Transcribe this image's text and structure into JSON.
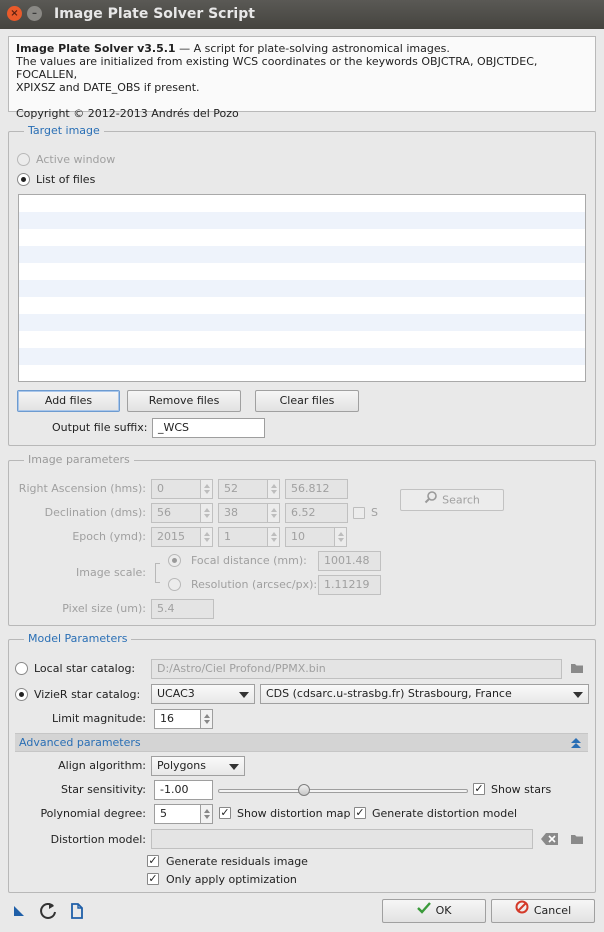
{
  "window": {
    "title": "Image Plate Solver Script",
    "close_glyph": "×",
    "min_glyph": "–"
  },
  "info": {
    "name": "Image Plate Solver v3.5.1",
    "tagline": " — A script for plate-solving astronomical images.",
    "line2": "The values are initialized from existing WCS coordinates or the keywords OBJCTRA, OBJCTDEC, FOCALLEN,",
    "line3": "XPIXSZ and DATE_OBS if present.",
    "copyright": "Copyright © 2012-2013 Andrés del Pozo"
  },
  "target": {
    "legend": "Target image",
    "active_window": "Active window",
    "list_of_files": "List of files",
    "add_files": "Add files",
    "remove_files": "Remove files",
    "clear_files": "Clear files",
    "suffix_label": "Output file suffix:",
    "suffix_value": "_WCS"
  },
  "image": {
    "legend": "Image parameters",
    "ra_label": "Right Ascension (hms):",
    "ra": [
      "0",
      "52",
      "56.812"
    ],
    "dec_label": "Declination (dms):",
    "dec": [
      "56",
      "38",
      "6.52"
    ],
    "s_label": "S",
    "epoch_label": "Epoch (ymd):",
    "epoch": [
      "2015",
      "1",
      "10"
    ],
    "search": "Search",
    "scale_label": "Image scale:",
    "focal_label": "Focal distance (mm):",
    "focal_value": "1001.48",
    "res_label": "Resolution (arcsec/px):",
    "res_value": "1.11219",
    "pixel_label": "Pixel size (um):",
    "pixel_value": "5.4"
  },
  "model": {
    "legend": "Model Parameters",
    "local_label": "Local star catalog:",
    "local_path": "D:/Astro/Ciel Profond/PPMX.bin",
    "vizier_label": "VizieR star catalog:",
    "vizier_catalog": "UCAC3",
    "vizier_server": "CDS (cdsarc.u-strasbg.fr) Strasbourg, France",
    "limit_label": "Limit magnitude:",
    "limit_value": "16",
    "advanced": "Advanced parameters",
    "align_label": "Align algorithm:",
    "align_value": "Polygons",
    "sens_label": "Star sensitivity:",
    "sens_value": "-1.00",
    "show_stars": "Show stars",
    "poly_label": "Polynomial degree:",
    "poly_value": "5",
    "show_map": "Show distortion map",
    "gen_model": "Generate distortion model",
    "dist_label": "Distortion model:",
    "residuals": "Generate residuals image",
    "only_opt": "Only apply optimization"
  },
  "footer": {
    "ok": "OK",
    "cancel": "Cancel"
  },
  "colors": {
    "accent": "#2a6fb5",
    "ok_check": "#3a9a3a",
    "cancel": "#d43a2a",
    "titlebar": "#4d4c48"
  },
  "check_glyph": "✓"
}
